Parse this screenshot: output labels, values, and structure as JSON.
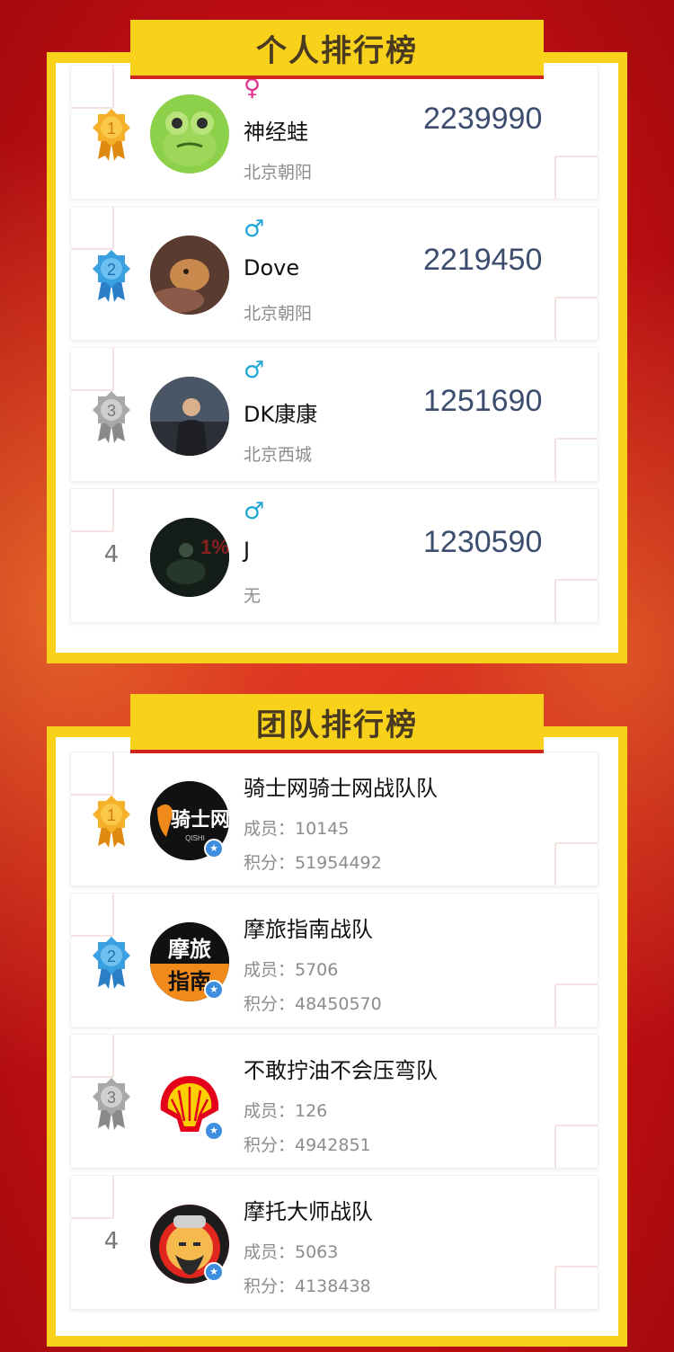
{
  "personal": {
    "title": "个人排行榜",
    "items": [
      {
        "rank": "1",
        "gender": "♀",
        "name": "神经蛙",
        "location": "北京朝阳",
        "score": "2239990"
      },
      {
        "rank": "2",
        "gender": "♂",
        "name": "Dove",
        "location": "北京朝阳",
        "score": "2219450"
      },
      {
        "rank": "3",
        "gender": "♂",
        "name": "DK康康",
        "location": "北京西城",
        "score": "1251690"
      },
      {
        "rank": "4",
        "gender": "♂",
        "name": "J",
        "location": "无",
        "score": "1230590"
      }
    ]
  },
  "team": {
    "title": "团队排行榜",
    "items": [
      {
        "rank": "1",
        "name": "骑士网骑士网战队队",
        "members": "成员：10145",
        "points": "积分：51954492",
        "logo_text": "骑士网",
        "logo_sub": "QISHI"
      },
      {
        "rank": "2",
        "name": "摩旅指南战队",
        "members": "成员：5706",
        "points": "积分：48450570",
        "logo_text": "摩旅",
        "logo_text2": "指南"
      },
      {
        "rank": "3",
        "name": "不敢拧油不会压弯队",
        "members": "成员：126",
        "points": "积分：4942851"
      },
      {
        "rank": "4",
        "name": "摩托大师战队",
        "members": "成员：5063",
        "points": "积分：4138438"
      }
    ]
  },
  "avatar_4_overlay": "1%",
  "colors": {
    "gold": "#f5a623",
    "silver_blue": "#3aa0e0",
    "bronze_gray": "#a8a8a8",
    "banner": "#f8d21a",
    "background": "#c20e14"
  }
}
